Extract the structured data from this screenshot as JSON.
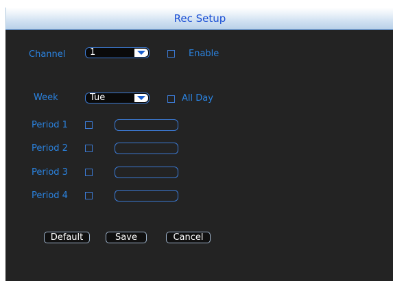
{
  "window": {
    "title": "Rec Setup"
  },
  "channel": {
    "label": "Channel",
    "selected": "1",
    "enable_label": "Enable",
    "enable_checked": false
  },
  "week": {
    "label": "Week",
    "selected": "Tue",
    "all_day_label": "All Day",
    "all_day_checked": false
  },
  "periods": [
    {
      "label": "Period 1",
      "checked": false,
      "value": ""
    },
    {
      "label": "Period 2",
      "checked": false,
      "value": ""
    },
    {
      "label": "Period 3",
      "checked": false,
      "value": ""
    },
    {
      "label": "Period 4",
      "checked": false,
      "value": ""
    }
  ],
  "buttons": {
    "default_label": "Default",
    "save_label": "Save",
    "cancel_label": "Cancel"
  },
  "colors": {
    "label_blue": "#2b83e0",
    "title_blue": "#1a4fd4",
    "panel_bg": "#232323"
  }
}
